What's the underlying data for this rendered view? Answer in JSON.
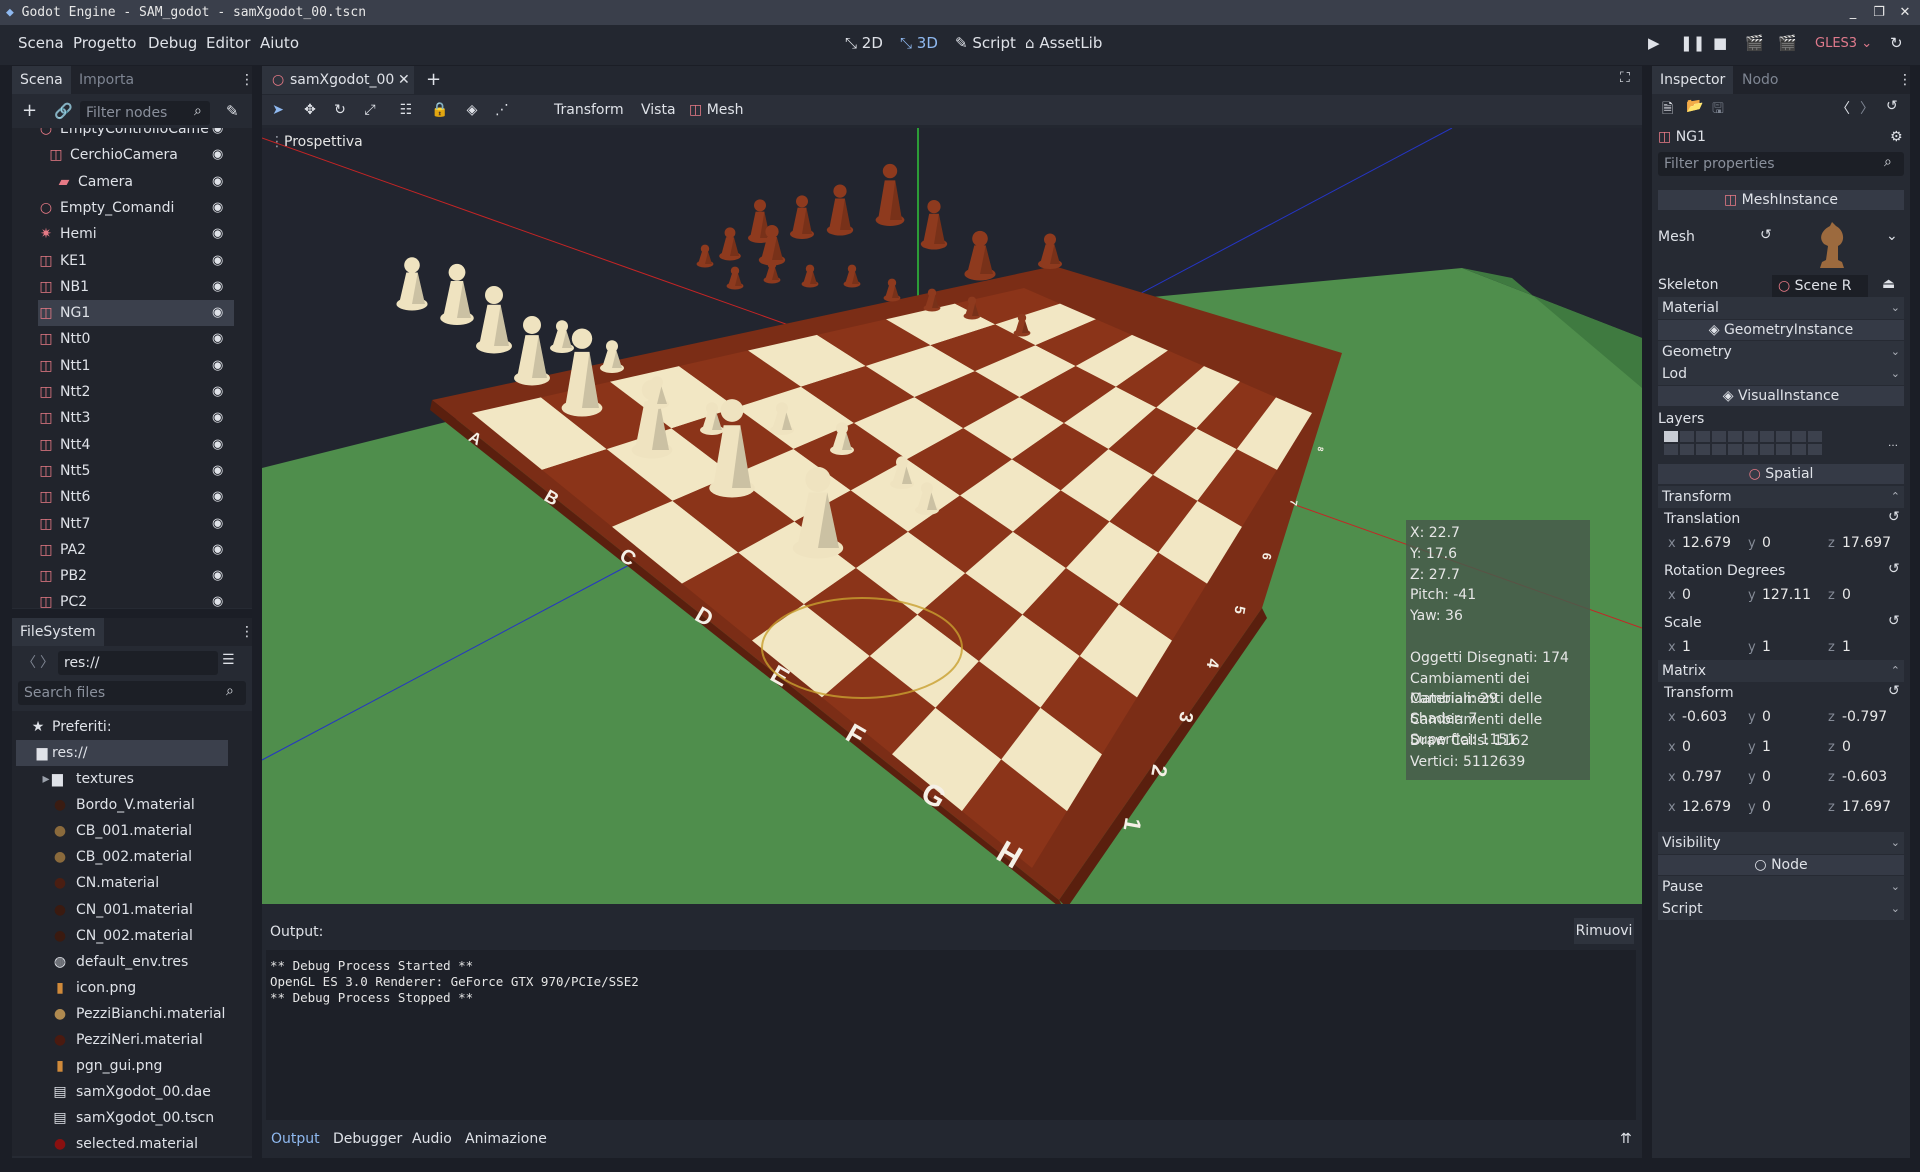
{
  "window": {
    "title": "Godot Engine - SAM_godot - samXgodot_00.tscn"
  },
  "menu": [
    "Scena",
    "Progetto",
    "Debug",
    "Editor",
    "Aiuto"
  ],
  "modes": [
    {
      "label": "2D",
      "icon": "2d-icon"
    },
    {
      "label": "3D",
      "icon": "3d-icon"
    },
    {
      "label": "Script",
      "icon": "script-icon"
    },
    {
      "label": "AssetLib",
      "icon": "assetlib-icon"
    }
  ],
  "renderer": "GLES3",
  "scene_dock": {
    "tabs": [
      "Scena",
      "Importa"
    ],
    "filter_placeholder": "Filter nodes",
    "nodes": [
      {
        "label": "EmptyControlloCame",
        "icon": "spatial-icon",
        "selected": false
      },
      {
        "label": "CerchioCamera",
        "icon": "mesh-icon",
        "selected": false
      },
      {
        "label": "Camera",
        "icon": "camera-icon",
        "selected": false
      },
      {
        "label": "Empty_Comandi",
        "icon": "spatial-icon",
        "selected": false
      },
      {
        "label": "Hemi",
        "icon": "light-icon",
        "selected": false
      },
      {
        "label": "KE1",
        "icon": "mesh-icon",
        "selected": false
      },
      {
        "label": "NB1",
        "icon": "mesh-icon",
        "selected": false
      },
      {
        "label": "NG1",
        "icon": "mesh-icon",
        "selected": true
      },
      {
        "label": "Ntt0",
        "icon": "mesh-icon",
        "selected": false
      },
      {
        "label": "Ntt1",
        "icon": "mesh-icon",
        "selected": false
      },
      {
        "label": "Ntt2",
        "icon": "mesh-icon",
        "selected": false
      },
      {
        "label": "Ntt3",
        "icon": "mesh-icon",
        "selected": false
      },
      {
        "label": "Ntt4",
        "icon": "mesh-icon",
        "selected": false
      },
      {
        "label": "Ntt5",
        "icon": "mesh-icon",
        "selected": false
      },
      {
        "label": "Ntt6",
        "icon": "mesh-icon",
        "selected": false
      },
      {
        "label": "Ntt7",
        "icon": "mesh-icon",
        "selected": false
      },
      {
        "label": "PA2",
        "icon": "mesh-icon",
        "selected": false
      },
      {
        "label": "PB2",
        "icon": "mesh-icon",
        "selected": false
      },
      {
        "label": "PC2",
        "icon": "mesh-icon",
        "selected": false
      }
    ]
  },
  "filesystem": {
    "tab": "FileSystem",
    "path": "res://",
    "search_placeholder": "Search files",
    "favorites": "Preferiti:",
    "root": "res://",
    "items": [
      {
        "label": "textures",
        "icon": "folder-icon"
      },
      {
        "label": "Bordo_V.material",
        "icon": "material-icon",
        "color": "#3a1c12"
      },
      {
        "label": "CB_001.material",
        "icon": "material-icon",
        "color": "#8a6a3c"
      },
      {
        "label": "CB_002.material",
        "icon": "material-icon",
        "color": "#8a6a3c"
      },
      {
        "label": "CN.material",
        "icon": "material-icon",
        "color": "#4a1e12"
      },
      {
        "label": "CN_001.material",
        "icon": "material-icon",
        "color": "#3a1a10"
      },
      {
        "label": "CN_002.material",
        "icon": "material-icon",
        "color": "#3a1a10"
      },
      {
        "label": "default_env.tres",
        "icon": "globe-icon",
        "color": "#dfe2e8"
      },
      {
        "label": "icon.png",
        "icon": "image-icon",
        "color": "#d08a3a"
      },
      {
        "label": "PezziBianchi.material",
        "icon": "material-icon",
        "color": "#b08a50"
      },
      {
        "label": "PezziNeri.material",
        "icon": "material-icon",
        "color": "#4a1a10"
      },
      {
        "label": "pgn_gui.png",
        "icon": "image-icon",
        "color": "#d08a3a"
      },
      {
        "label": "samXgodot_00.dae",
        "icon": "scene-icon",
        "color": "#dfe2e8"
      },
      {
        "label": "samXgodot_00.tscn",
        "icon": "scene-icon",
        "color": "#dfe2e8"
      },
      {
        "label": "selected.material",
        "icon": "material-icon",
        "color": "#8a1010"
      }
    ]
  },
  "editor_tab": {
    "label": "samXgodot_00"
  },
  "toolbar": {
    "transform": "Transform",
    "vista": "Vista",
    "mesh": "Mesh"
  },
  "viewport": {
    "perspective_label": "Prospettiva",
    "stats": [
      "X: 22.7",
      "Y: 17.6",
      "Z: 27.7",
      "Pitch: -41",
      "Yaw: 36",
      "",
      "Oggetti Disegnati: 174",
      "Cambiamenti dei Materiali: 29",
      "Cambiamenti delle Shader: 7",
      "Cambiamenti delle Superfici: 1151",
      "Draw Calls: 1162",
      "Vertici: 5112639"
    ],
    "board_files": [
      "A",
      "B",
      "C",
      "D",
      "E",
      "F",
      "G",
      "H"
    ],
    "board_ranks": [
      "8",
      "7",
      "6",
      "5",
      "4",
      "3",
      "2",
      "1"
    ],
    "colors": {
      "floor": "#4f8e4c",
      "board_wood": "#7b2d16",
      "light_square": "#f2e7c4",
      "dark_square": "#8b3419",
      "white_piece": "#efe3c0",
      "black_piece": "#8e3a1e"
    }
  },
  "output": {
    "title": "Output:",
    "clear_button": "Rimuovi",
    "lines": [
      "** Debug Process Started **",
      "OpenGL ES 3.0 Renderer: GeForce GTX 970/PCIe/SSE2",
      "** Debug Process Stopped **"
    ],
    "bottom_tabs": [
      "Output",
      "Debugger",
      "Audio",
      "Animazione"
    ]
  },
  "inspector": {
    "tabs": [
      "Inspector",
      "Nodo"
    ],
    "node_name": "NG1",
    "filter_placeholder": "Filter properties",
    "class_meshinstance": "MeshInstance",
    "mesh_label": "Mesh",
    "skeleton_label": "Skeleton",
    "skeleton_value": "Scene R",
    "material_label": "Material",
    "class_geometry": "GeometryInstance",
    "geometry_label": "Geometry",
    "lod_label": "Lod",
    "class_visual": "VisualInstance",
    "layers_label": "Layers",
    "class_spatial": "Spatial",
    "transform_label": "Transform",
    "translation_label": "Translation",
    "translation": {
      "x": "12.679",
      "y": "0",
      "z": "17.697"
    },
    "rotation_label": "Rotation Degrees",
    "rotation": {
      "x": "0",
      "y": "127.11",
      "z": "0"
    },
    "scale_label": "Scale",
    "scale": {
      "x": "1",
      "y": "1",
      "z": "1"
    },
    "matrix_label": "Matrix",
    "matrix_transform_label": "Transform",
    "matrix": [
      {
        "x": "-0.603",
        "y": "0",
        "z": "-0.797"
      },
      {
        "x": "0",
        "y": "1",
        "z": "0"
      },
      {
        "x": "0.797",
        "y": "0",
        "z": "-0.603"
      },
      {
        "x": "12.679",
        "y": "0",
        "z": "17.697"
      }
    ],
    "visibility_label": "Visibility",
    "class_node": "Node",
    "pause_label": "Pause",
    "script_label": "Script"
  }
}
